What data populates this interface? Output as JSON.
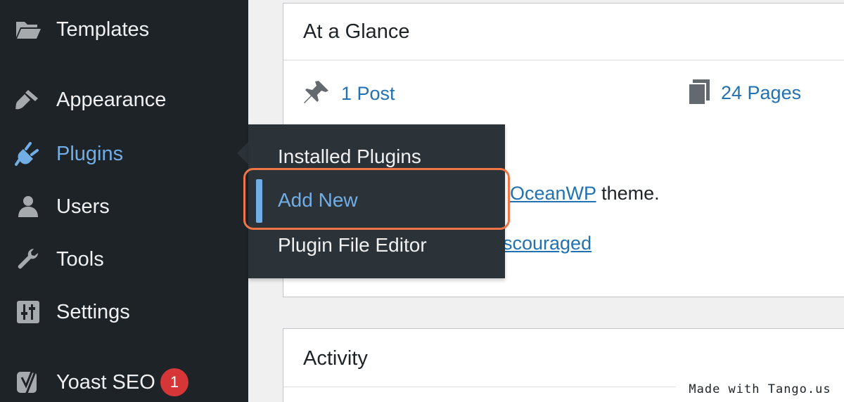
{
  "sidebar": {
    "items": [
      {
        "label": "Templates",
        "icon": "folder-icon"
      },
      {
        "label": "Appearance",
        "icon": "paintbrush-icon"
      },
      {
        "label": "Plugins",
        "icon": "plug-icon"
      },
      {
        "label": "Users",
        "icon": "user-icon"
      },
      {
        "label": "Tools",
        "icon": "wrench-icon"
      },
      {
        "label": "Settings",
        "icon": "sliders-icon"
      },
      {
        "label": "Yoast SEO",
        "icon": "yoast-icon",
        "badge": "1"
      }
    ],
    "active_item": "Plugins"
  },
  "flyout": {
    "items": [
      {
        "label": "Installed Plugins"
      },
      {
        "label": "Add New"
      },
      {
        "label": "Plugin File Editor"
      }
    ],
    "current_item": "Add New"
  },
  "at_a_glance": {
    "title": "At a Glance",
    "posts": "1 Post",
    "pages": "24 Pages",
    "theme_link": "OceanWP",
    "theme_suffix": " theme.",
    "partial_link": "scouraged"
  },
  "activity": {
    "title": "Activity"
  },
  "watermark": "Made with Tango.us",
  "colors": {
    "sidebar_bg": "#1d2327",
    "flyout_bg": "#2c3338",
    "accent": "#72aee6",
    "link": "#2271b1",
    "highlight": "#ef7547",
    "badge": "#d63638"
  }
}
